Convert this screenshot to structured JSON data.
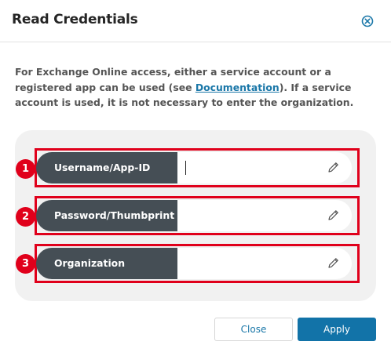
{
  "dialog": {
    "title": "Read Credentials"
  },
  "description": {
    "before_link": "For Exchange Online access, either a service account or a registered app can be used (see ",
    "link": "Documentation",
    "after_link": "). If a service account is used, it is not necessary to enter the organization."
  },
  "fields": [
    {
      "badge": "1",
      "label": "Username/App-ID",
      "value": ""
    },
    {
      "badge": "2",
      "label": "Password/Thumbprint",
      "value": ""
    },
    {
      "badge": "3",
      "label": "Organization",
      "value": ""
    }
  ],
  "buttons": {
    "close": "Close",
    "apply": "Apply"
  },
  "colors": {
    "label_bg": "#454e55",
    "highlight": "#e0001b",
    "primary": "#1273a8",
    "link": "#1a77a8"
  },
  "icons": {
    "close": "close-circle-icon",
    "edit": "pencil-icon"
  }
}
